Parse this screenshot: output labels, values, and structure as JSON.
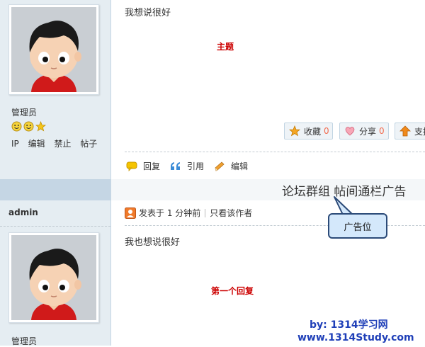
{
  "post1": {
    "usergroup": "管理员",
    "admin_links": [
      "IP",
      "编辑",
      "禁止",
      "帖子"
    ],
    "text": "我想说很好",
    "annotation": "主题",
    "buttons": [
      {
        "label": "收藏",
        "count": "0",
        "icon": "star-icon"
      },
      {
        "label": "分享",
        "count": "0",
        "icon": "heart-icon"
      },
      {
        "label": "支持",
        "icon": "up-arrow-icon"
      }
    ],
    "actions": [
      {
        "label": "回复",
        "icon": "reply-bubble-icon"
      },
      {
        "label": "引用",
        "icon": "quote-icon"
      },
      {
        "label": "编辑",
        "icon": "pencil-icon"
      }
    ]
  },
  "banner": {
    "ad_text": "论坛群组 帖间通栏广告",
    "callout": "广告位"
  },
  "post2": {
    "username": "admin",
    "posted": "发表于 1 分钟前",
    "author_only": "只看该作者",
    "text": "我也想说很好",
    "annotation": "第一个回复",
    "usergroup": "管理员"
  },
  "watermark": {
    "line1": "by: 1314学习网",
    "line2": "www.1314Study.com"
  },
  "colors": {
    "sidebar_bg": "#e5edf2",
    "annotation_red": "#cc0000",
    "count_orange": "#f26c4f",
    "watermark_blue": "#1f3fb8",
    "callout_bg": "#d4e8fb"
  }
}
